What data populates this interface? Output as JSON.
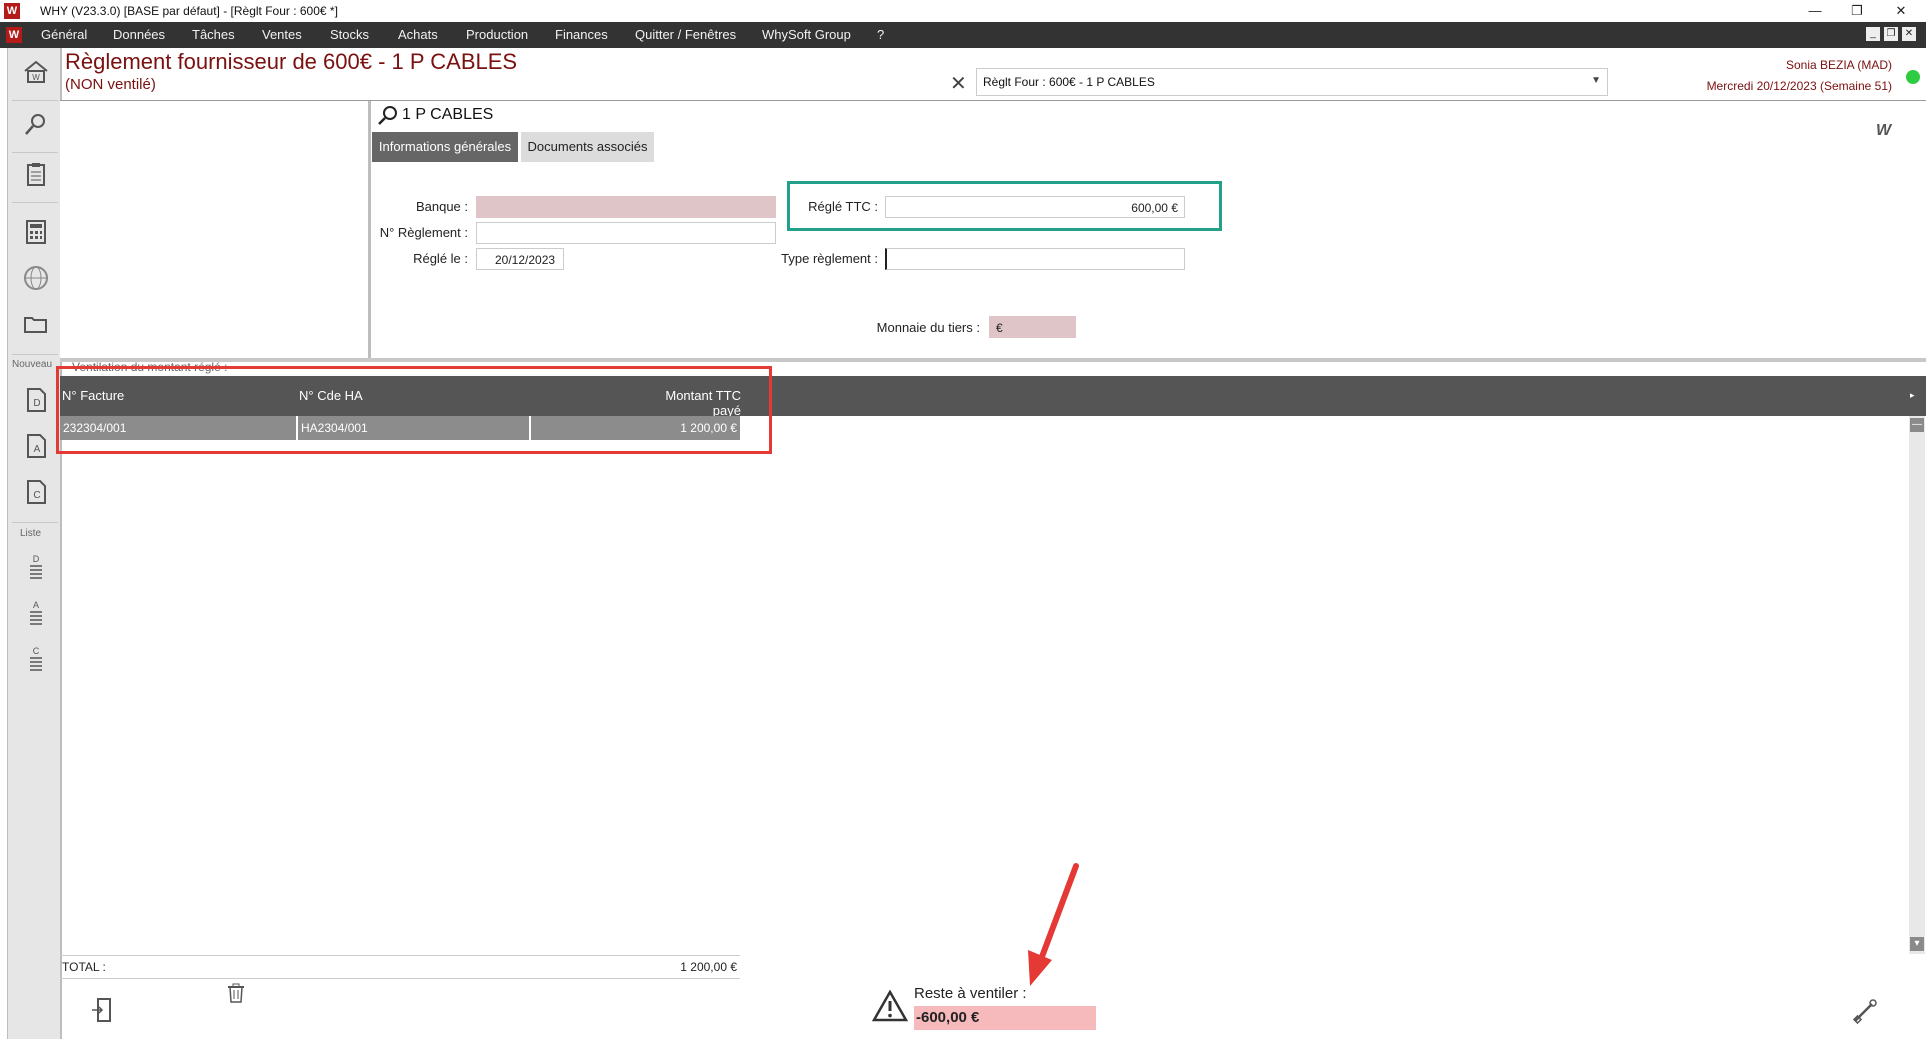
{
  "window": {
    "title": "WHY (V23.3.0)  [BASE par défaut] - [Règlt Four : 600€ *]",
    "logo": "W",
    "controls": {
      "minimize": "—",
      "restore": "❐",
      "close": "✕"
    }
  },
  "menu": {
    "logo": "W",
    "items": [
      "Général",
      "Données",
      "Tâches",
      "Ventes",
      "Stocks",
      "Achats",
      "Production",
      "Finances",
      "Quitter / Fenêtres",
      "WhySoft Group",
      "?"
    ],
    "mdi": {
      "minimize": "_",
      "restore": "❐",
      "close": "✕"
    }
  },
  "sidebar": {
    "icons": [
      "home-icon",
      "search-icon",
      "clipboard-icon",
      "calculator-icon",
      "globe-icon",
      "folder-icon"
    ],
    "nouveau_label": "Nouveau",
    "new_items": [
      "D",
      "A",
      "C"
    ],
    "liste_label": "Liste",
    "list_items": [
      "D",
      "A",
      "C"
    ]
  },
  "header": {
    "title": "Règlement fournisseur de 600€ - 1 P CABLES",
    "subtitle": "(NON ventilé)",
    "doc_selector": "Règlt Four : 600€ - 1 P CABLES",
    "user": "Sonia BEZIA (MAD)",
    "date": "Mercredi 20/12/2023 (Semaine 51)",
    "status_color": "#2ecc40"
  },
  "form": {
    "supplier": "1 P CABLES",
    "brand": "W",
    "tabs": [
      "Informations générales",
      "Documents associés"
    ],
    "active_tab": "Informations générales",
    "banque_label": "Banque :",
    "banque_value": "",
    "num_reglement_label": "N° Règlement :",
    "num_reglement_value": "",
    "regle_le_label": "Réglé le :",
    "regle_le_value": "20/12/2023",
    "regle_ttc_label": "Réglé TTC :",
    "regle_ttc_value": "600,00 €",
    "type_reglement_label": "Type règlement :",
    "type_reglement_value": "",
    "monnaie_label": "Monnaie du tiers :",
    "monnaie_value": "€"
  },
  "grid": {
    "section_label": "Ventilation du montant réglé :",
    "columns": [
      "N° Facture",
      "N° Cde HA",
      "Montant TTC payé"
    ],
    "rows": [
      {
        "facture": "232304/001",
        "cde": "HA2304/001",
        "montant": "1 200,00 €"
      }
    ],
    "total_label": "TOTAL :",
    "total_value": "1 200,00 €"
  },
  "footer": {
    "reste_label": "Reste à ventiler :",
    "reste_value": "-600,00 €"
  },
  "annotations": {
    "green_box_color": "#23a08a",
    "red_box_color": "#e53935",
    "arrow_color": "#e53935"
  }
}
